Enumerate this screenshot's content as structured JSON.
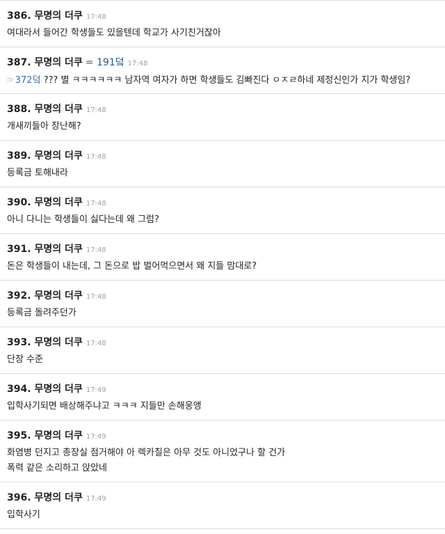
{
  "posts": [
    {
      "num": "386.",
      "name": "무명의 더쿠",
      "time": "17:48",
      "lines": [
        "여대라서 들어간 학생들도 있을텐데 학교가 사기친거잖아"
      ]
    },
    {
      "num": "387.",
      "name": "무명의 더쿠",
      "id": "= 191덬",
      "time": "17:48",
      "reply_ref": "372덬",
      "lines": [
        "??? 별 ㅋㅋㅋㅋㅋㅋ 남자역 여자가 하면 학생들도 김빠진다 ㅇㅈㄹ하네 제정신인가 지가 학생임?"
      ]
    },
    {
      "num": "388.",
      "name": "무명의 더쿠",
      "time": "17:48",
      "lines": [
        "개새끼들아 장난해?"
      ]
    },
    {
      "num": "389.",
      "name": "무명의 더쿠",
      "time": "17:48",
      "lines": [
        "등록금 토해내라"
      ]
    },
    {
      "num": "390.",
      "name": "무명의 더쿠",
      "time": "17:48",
      "lines": [
        "아니 다니는 학생들이 싫다는데 왜 그럼?"
      ]
    },
    {
      "num": "391.",
      "name": "무명의 더쿠",
      "time": "17:48",
      "lines": [
        "돈은 학생들이 내는데, 그 돈으로 밥 벌어먹으면서 왜 지들 맘대로?"
      ]
    },
    {
      "num": "392.",
      "name": "무명의 더쿠",
      "time": "17:48",
      "lines": [
        "등록금 돌려주던가"
      ]
    },
    {
      "num": "393.",
      "name": "무명의 더쿠",
      "time": "17:48",
      "lines": [
        "단장 수준"
      ]
    },
    {
      "num": "394.",
      "name": "무명의 더쿠",
      "time": "17:49",
      "lines": [
        "입학사기되면 배상해주냐고 ㅋㅋㅋ 지들만 손해웅앵"
      ]
    },
    {
      "num": "395.",
      "name": "무명의 더쿠",
      "time": "17:49",
      "lines": [
        "화염병 던지고 총장실 점거해야 아 렉카칠은 아무 것도 아니었구나 할 건가",
        "폭력 같은 소리하고 앉았네"
      ]
    },
    {
      "num": "396.",
      "name": "무명의 더쿠",
      "time": "17:49",
      "lines": [
        "입학사기"
      ]
    }
  ],
  "icons": {
    "reply": "pointing-hand-icon"
  },
  "colors": {
    "reply_link": "#3a6fb0",
    "time": "#a0a0a0",
    "divider": "#dcdcdc"
  }
}
